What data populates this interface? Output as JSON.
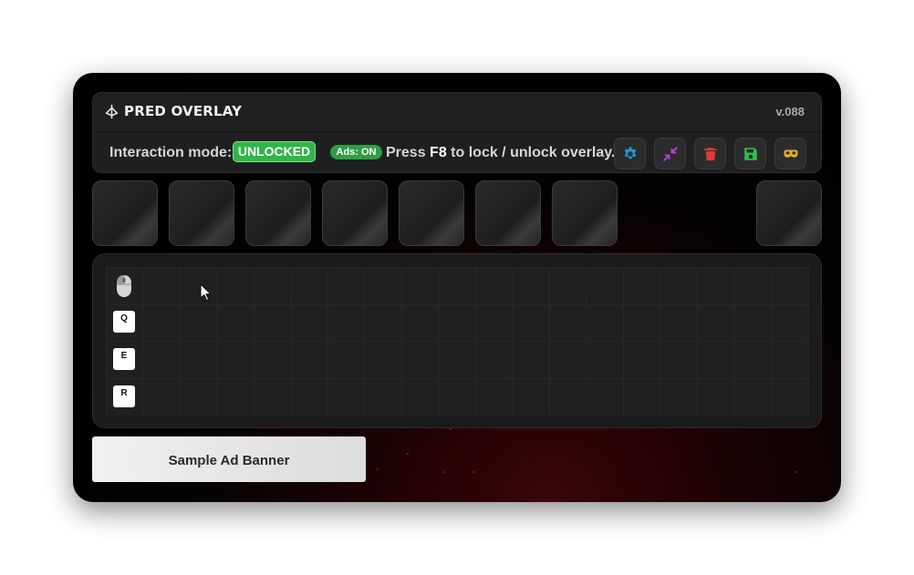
{
  "app": {
    "title": "PRED OVERLAY",
    "version": "v.088"
  },
  "mode_bar": {
    "label": "Interaction mode:",
    "mode_state": "UNLOCKED",
    "ads_badge": "Ads: ON",
    "hint_prefix": "Press",
    "hint_key": "F8",
    "hint_suffix": "to lock / unlock overlay."
  },
  "toolbar_buttons": [
    {
      "name": "settings",
      "icon": "gear-icon",
      "color": "#1a9fe0"
    },
    {
      "name": "minimize",
      "icon": "compress-arrows-icon",
      "color": "#b23fd0"
    },
    {
      "name": "delete",
      "icon": "trash-icon",
      "color": "#e03838"
    },
    {
      "name": "save",
      "icon": "floppy-disk-icon",
      "color": "#2fbf4f"
    },
    {
      "name": "view",
      "icon": "mask-icon",
      "color": "#e0b224"
    }
  ],
  "ability_slots": [
    {
      "name": "slot-1"
    },
    {
      "name": "slot-2"
    },
    {
      "name": "slot-3"
    },
    {
      "name": "slot-4"
    },
    {
      "name": "slot-5"
    },
    {
      "name": "slot-6"
    },
    {
      "name": "slot-7"
    },
    {
      "name": "slot-extra"
    }
  ],
  "timeline": {
    "rows": [
      {
        "icon": "mouse-icon",
        "label": ""
      },
      {
        "icon": "key-icon",
        "label": "Q"
      },
      {
        "icon": "key-icon",
        "label": "E"
      },
      {
        "icon": "key-icon",
        "label": "R"
      }
    ]
  },
  "ad_banner": {
    "text": "Sample Ad Banner"
  },
  "colors": {
    "accent_green": "#30b54a",
    "background": "#000000",
    "panel": "#1f1f20"
  }
}
